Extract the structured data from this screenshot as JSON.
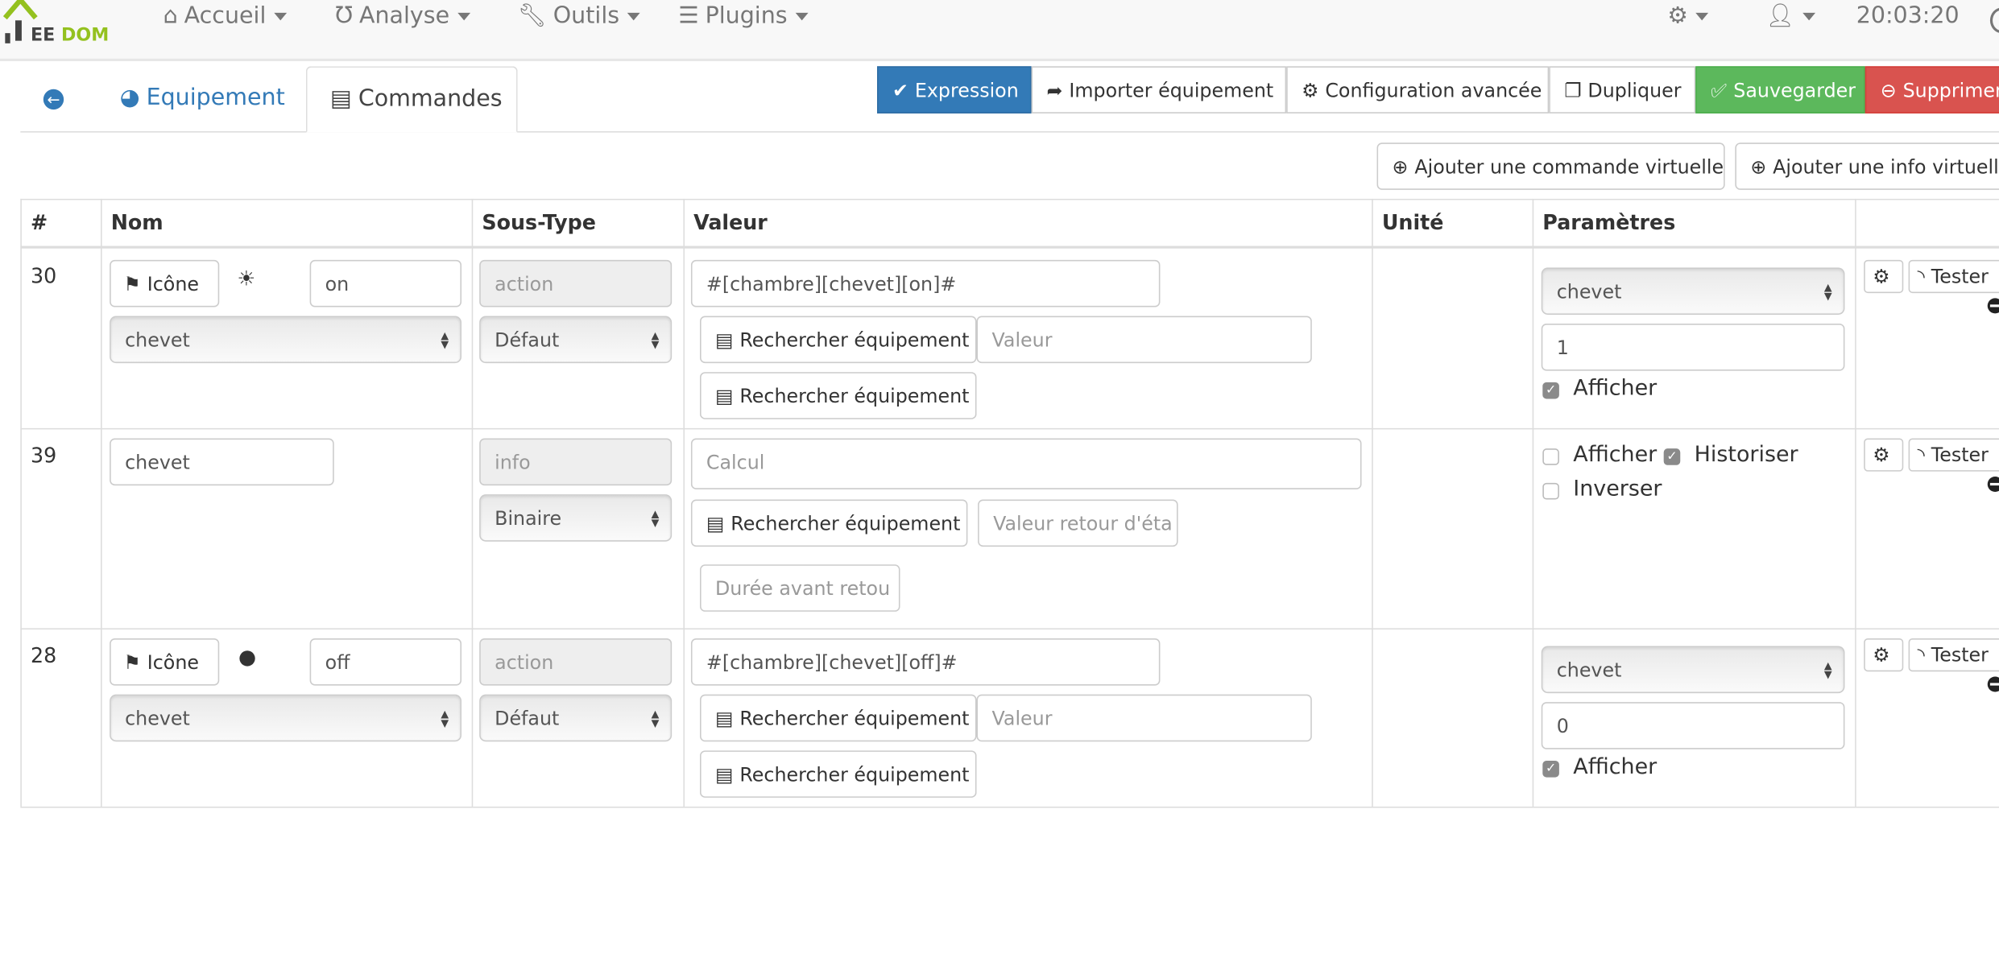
{
  "navbar": {
    "logo": "JEEDOM",
    "items": [
      {
        "label": "Accueil",
        "icon": "home-icon"
      },
      {
        "label": "Analyse",
        "icon": "stethoscope-icon"
      },
      {
        "label": "Outils",
        "icon": "wrench-icon"
      },
      {
        "label": "Plugins",
        "icon": "tasks-icon"
      }
    ],
    "time": "20:03:20"
  },
  "tabs": [
    {
      "label": "",
      "icon": "arrow-circle-left-icon"
    },
    {
      "label": "Equipement",
      "icon": "tachometer-icon"
    },
    {
      "label": "Commandes",
      "icon": "list-alt-icon",
      "active": true
    }
  ],
  "toolbar": {
    "expression": "Expression",
    "import": "Importer équipement",
    "config": "Configuration avancée",
    "duplicate": "Dupliquer",
    "save": "Sauvegarder",
    "delete": "Supprimer"
  },
  "actions": {
    "add_command": "Ajouter une commande virtuelle",
    "add_info": "Ajouter une info virtuelle"
  },
  "colors": {
    "primary": "#337ab7",
    "success": "#5cb85c",
    "danger": "#d9534f",
    "logo_green": "#94c11f"
  },
  "table": {
    "headers": [
      "#",
      "Nom",
      "Sous-Type",
      "Valeur",
      "Unité",
      "Paramètres",
      ""
    ],
    "rows": [
      {
        "id": "30",
        "icon_button": "Icône",
        "icon": "lightbulb-on-icon",
        "name": "on",
        "object": "chevet",
        "type": "action",
        "subtype": "Défaut",
        "value": "#[chambre][chevet][on]#",
        "search1": "Rechercher équipement",
        "value_placeholder": "Valeur",
        "search2": "Rechercher équipement",
        "param_select": "chevet",
        "param_value": "1",
        "afficher": "Afficher",
        "afficher_checked": true,
        "test": "Tester"
      },
      {
        "id": "39",
        "name": "chevet",
        "type": "info",
        "subtype": "Binaire",
        "calc_placeholder": "Calcul",
        "search": "Rechercher équipement",
        "return_placeholder": "Valeur retour d'éta",
        "duration_placeholder": "Durée avant retou",
        "afficher": "Afficher",
        "afficher_checked": false,
        "historiser": "Historiser",
        "historiser_checked": true,
        "inverser": "Inverser",
        "inverser_checked": false,
        "test": "Tester"
      },
      {
        "id": "28",
        "icon_button": "Icône",
        "icon": "lightbulb-icon",
        "name": "off",
        "object": "chevet",
        "type": "action",
        "subtype": "Défaut",
        "value": "#[chambre][chevet][off]#",
        "search1": "Rechercher équipement",
        "value_placeholder": "Valeur",
        "search2": "Rechercher équipement",
        "param_select": "chevet",
        "param_value": "0",
        "afficher": "Afficher",
        "afficher_checked": true,
        "test": "Tester"
      }
    ]
  }
}
